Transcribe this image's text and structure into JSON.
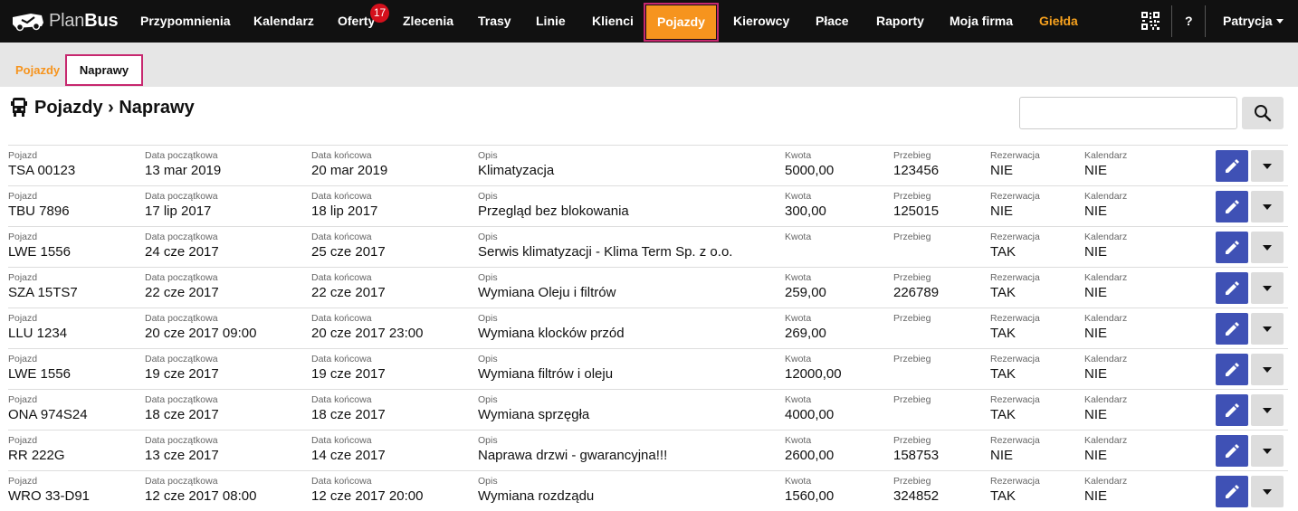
{
  "brand": {
    "name_light": "Plan",
    "name_bold": "Bus"
  },
  "nav": {
    "items": [
      {
        "label": "Przypomnienia"
      },
      {
        "label": "Kalendarz"
      },
      {
        "label": "Oferty",
        "badge": "17"
      },
      {
        "label": "Zlecenia"
      },
      {
        "label": "Trasy"
      },
      {
        "label": "Linie"
      },
      {
        "label": "Klienci"
      },
      {
        "label": "Pojazdy",
        "active": true
      },
      {
        "label": "Kierowcy"
      },
      {
        "label": "Płace"
      },
      {
        "label": "Raporty"
      },
      {
        "label": "Moja firma"
      },
      {
        "label": "Giełda"
      }
    ],
    "help_label": "?",
    "user_label": "Patrycja"
  },
  "subnav": {
    "link_label": "Pojazdy",
    "active_label": "Naprawy"
  },
  "page": {
    "title": "Pojazdy › Naprawy",
    "search_value": ""
  },
  "columns": [
    "Pojazd",
    "Data początkowa",
    "Data końcowa",
    "Opis",
    "Kwota",
    "Przebieg",
    "Rezerwacja",
    "Kalendarz"
  ],
  "rows": [
    [
      "TSA 00123",
      "13 mar 2019",
      "20 mar 2019",
      "Klimatyzacja",
      "5000,00",
      "123456",
      "NIE",
      "NIE"
    ],
    [
      "TBU 7896",
      "17 lip 2017",
      "18 lip 2017",
      "Przegląd bez blokowania",
      "300,00",
      "125015",
      "NIE",
      "NIE"
    ],
    [
      "LWE 1556",
      "24 cze 2017",
      "25 cze 2017",
      "Serwis klimatyzacji - Klima Term Sp. z o.o.",
      "",
      "",
      "TAK",
      "NIE"
    ],
    [
      "SZA 15TS7",
      "22 cze 2017",
      "22 cze 2017",
      "Wymiana Oleju i filtrów",
      "259,00",
      "226789",
      "TAK",
      "NIE"
    ],
    [
      "LLU 1234",
      "20 cze 2017 09:00",
      "20 cze 2017 23:00",
      "Wymiana klocków przód",
      "269,00",
      "",
      "TAK",
      "NIE"
    ],
    [
      "LWE 1556",
      "19 cze 2017",
      "19 cze 2017",
      "Wymiana filtrów i oleju",
      "12000,00",
      "",
      "TAK",
      "NIE"
    ],
    [
      "ONA 974S24",
      "18 cze 2017",
      "18 cze 2017",
      "Wymiana sprzęgła",
      "4000,00",
      "",
      "TAK",
      "NIE"
    ],
    [
      "RR 222G",
      "13 cze 2017",
      "14 cze 2017",
      "Naprawa drzwi - gwarancyjna!!!",
      "2600,00",
      "158753",
      "NIE",
      "NIE"
    ],
    [
      "WRO 33-D91",
      "12 cze 2017 08:00",
      "12 cze 2017 20:00",
      "Wymiana rozdządu",
      "1560,00",
      "324852",
      "TAK",
      "NIE"
    ]
  ]
}
